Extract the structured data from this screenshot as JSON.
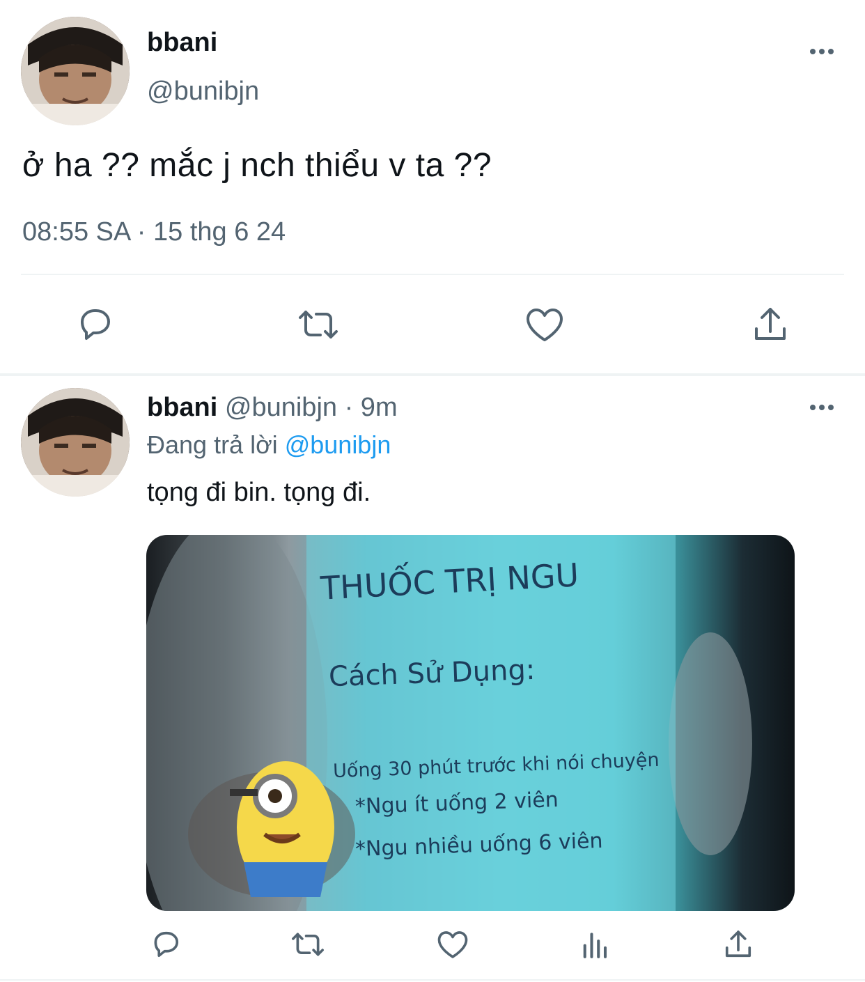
{
  "main_tweet": {
    "display_name": "bbani",
    "handle": "@bunibjn",
    "text": "ở ha ?? mắc j nch thiểu v ta ??",
    "timestamp": "08:55 SA · 15 thg 6 24",
    "actions": [
      "reply",
      "retweet",
      "like",
      "share"
    ]
  },
  "reply_tweet": {
    "display_name": "bbani",
    "handle": "@bunibjn",
    "time": "· 9m",
    "replying_prefix": "Đang trả lời",
    "replying_to": "@bunibjn",
    "text": "tọng đi bin. tọng đi.",
    "media_text": {
      "title": "THUỐC TRỊ NGU",
      "usage": "Cách Sử Dụng:",
      "line1": "Uống 30 phút trước khi nói chuyện",
      "line2": "*Ngu ít uống 2 viên",
      "line3": "*Ngu nhiều uống 6 viên"
    },
    "actions": [
      "reply",
      "retweet",
      "like",
      "analytics",
      "share"
    ]
  },
  "colors": {
    "text_primary": "#0f1419",
    "text_secondary": "#536471",
    "link": "#1d9bf0",
    "divider": "#eff3f4"
  }
}
